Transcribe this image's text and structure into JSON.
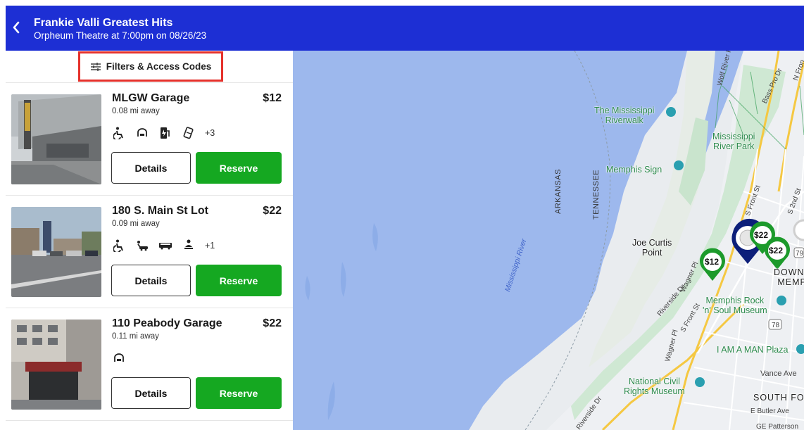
{
  "header": {
    "title": "Frankie Valli Greatest Hits",
    "subtitle": "Orpheum Theatre  at 7:00pm on 08/26/23"
  },
  "filters": {
    "label": "Filters & Access Codes"
  },
  "listings": [
    {
      "name": "MLGW Garage",
      "price": "$12",
      "distance": "0.08 mi away",
      "amenities": [
        "wheelchair-icon",
        "covered-garage-icon",
        "ev-charging-icon",
        "mobile-pass-icon"
      ],
      "more": "+3",
      "details_label": "Details",
      "reserve_label": "Reserve"
    },
    {
      "name": "180 S. Main St Lot",
      "price": "$22",
      "distance": "0.09 mi away",
      "amenities": [
        "wheelchair-icon",
        "valet-icon",
        "shuttle-icon",
        "self-park-icon"
      ],
      "more": "+1",
      "details_label": "Details",
      "reserve_label": "Reserve"
    },
    {
      "name": "110 Peabody Garage",
      "price": "$22",
      "distance": "0.11 mi away",
      "amenities": [
        "covered-garage-icon"
      ],
      "more": "",
      "details_label": "Details",
      "reserve_label": "Reserve"
    }
  ],
  "map": {
    "places": {
      "riverwalk": "The Mississippi\nRiverwalk",
      "river_park": "Mississippi\nRiver Park",
      "memphis_sign": "Memphis Sign",
      "joe_curtis": "Joe Curtis\nPoint",
      "rock_soul": "Memphis Rock\n'n' Soul Museum",
      "i_am_a_man": "I AM A MAN Plaza",
      "civil_rights": "National Civil\nRights Museum",
      "downtown": "DOWNT\nMEMP",
      "south_fo": "SOUTH FO"
    },
    "states": {
      "arkansas": "ARKANSAS",
      "tennessee": "TENNESSEE"
    },
    "river": "Mississippi River",
    "streets": {
      "wolf_river": "Wolf River H",
      "n_front": "N Fron",
      "bass_pro": "Bass Pro Dr",
      "s_front": "S Front St",
      "s_front2": "S Front St",
      "s_2nd": "S 2nd St",
      "riverside": "Riverside Dr",
      "riverside2": "Riverside Dr",
      "wagner": "Wagner Pl",
      "wagner2": "Wagner Pl",
      "vance": "Vance Ave",
      "butler": "E Butler Ave",
      "patterson": "GE Patterson",
      "route79": "79",
      "route78": "78"
    },
    "pins": [
      {
        "price": "$12",
        "selected": false
      },
      {
        "price": "$22",
        "selected": false
      },
      {
        "price": "$22",
        "selected": false
      },
      {
        "price": "",
        "selected": true
      }
    ]
  },
  "colors": {
    "header_bg": "#1d2fd4",
    "reserve_bg": "#15a821",
    "filter_highlight": "#e5312b",
    "water": "#9db8ed",
    "pin_green": "#1c9a2b",
    "pin_selected": "#0d1f7a"
  }
}
